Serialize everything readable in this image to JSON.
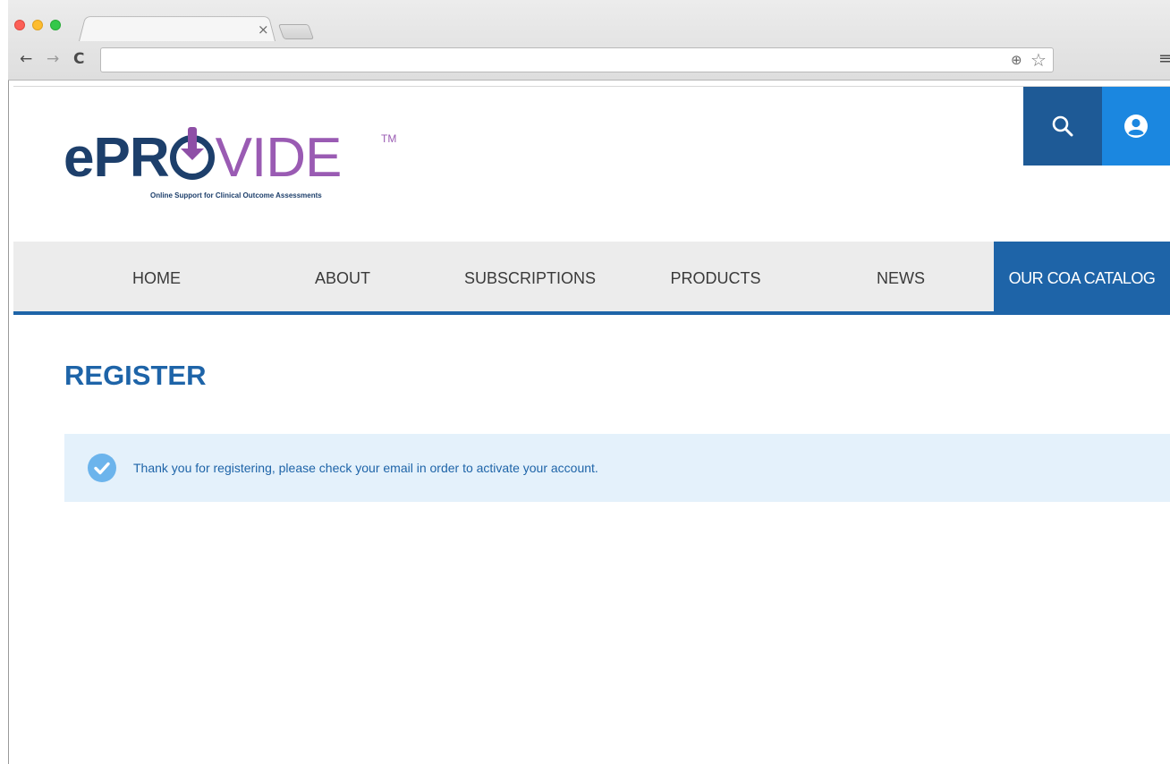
{
  "browser": {
    "tab_close": "×",
    "back_icon": "←",
    "forward_icon": "→",
    "reload_icon": "C",
    "menu_icon": "≡",
    "zoom_icon": "⊕",
    "star_icon": "☆"
  },
  "brand": {
    "logo_e": "e",
    "logo_pr": "PR",
    "logo_vide": "VIDE",
    "logo_tm": "TM",
    "tagline": "Online Support for Clinical Outcome Assessments",
    "primary_color": "#1e64a8",
    "accent_color": "#9a5bb3"
  },
  "header": {
    "search_icon": "search-icon",
    "user_icon": "user-icon"
  },
  "nav": {
    "items": [
      {
        "label": "HOME"
      },
      {
        "label": "ABOUT"
      },
      {
        "label": "SUBSCRIPTIONS"
      },
      {
        "label": "PRODUCTS"
      },
      {
        "label": "NEWS"
      },
      {
        "label": "OUR COA CATALOG",
        "active": true
      }
    ]
  },
  "main": {
    "title": "REGISTER",
    "alert": {
      "icon": "check-circle-icon",
      "message": "Thank you for registering, please check your email in order to activate your account."
    }
  }
}
